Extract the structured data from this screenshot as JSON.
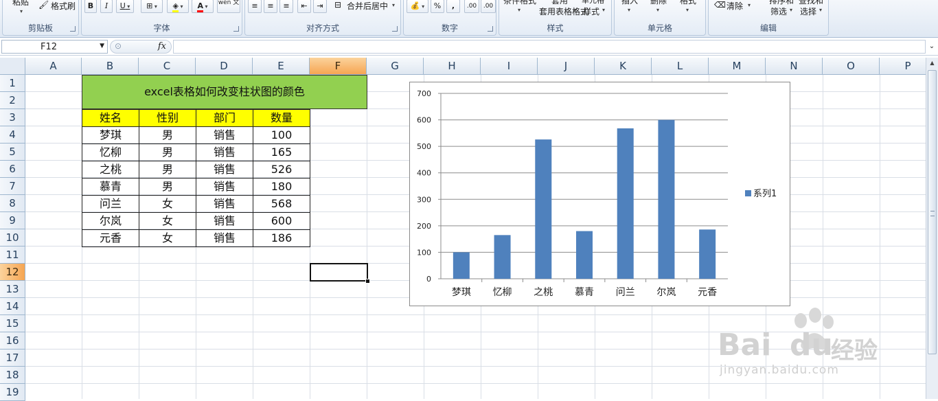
{
  "ribbon": {
    "groups": [
      {
        "label": "剪贴板"
      },
      {
        "label": "字体"
      },
      {
        "label": "对齐方式"
      },
      {
        "label": "数字"
      },
      {
        "label": "样式"
      },
      {
        "label": "单元格"
      },
      {
        "label": "编辑"
      }
    ],
    "clipboard": {
      "paste_label": "粘贴",
      "format_painter_label": "格式刷"
    },
    "font": {
      "bold": "B",
      "italic": "I",
      "underline": "U",
      "font_color": "A",
      "phonetic": "wén 文"
    },
    "alignment": {
      "merge_center_label": "合并后居中"
    },
    "number": {
      "percent": "%",
      "comma": ",",
      "inc_decimal": ".00",
      "dec_decimal": ".00"
    },
    "styles": {
      "conditional_label": "条件格式",
      "table_format_label": "套用表格格式",
      "cell_style_label": "单元格样式"
    },
    "cells": {
      "insert_label": "插入",
      "delete_label": "删除",
      "format_label": "格式"
    },
    "editing": {
      "clear_label": "清除",
      "sort_filter_label": "排序和筛选",
      "find_select_label": "查找和选择"
    }
  },
  "formula_bar": {
    "name_box": "F12",
    "fx": "fx",
    "formula": ""
  },
  "sheet": {
    "columns": [
      "A",
      "B",
      "C",
      "D",
      "E",
      "F",
      "G",
      "H",
      "I",
      "J",
      "K",
      "L",
      "M",
      "N",
      "O",
      "P"
    ],
    "selected_column": "F",
    "rows": [
      "1",
      "2",
      "3",
      "4",
      "5",
      "6",
      "7",
      "8",
      "9",
      "10",
      "11",
      "12",
      "13",
      "14",
      "15",
      "16",
      "17",
      "18",
      "19"
    ],
    "selected_row": "12",
    "title": "excel表格如何改变柱状图的颜色",
    "title_color": "#92d050",
    "header_color": "#ffff00",
    "headers": [
      "姓名",
      "性别",
      "部门",
      "数量"
    ],
    "table": [
      [
        "梦琪",
        "男",
        "销售",
        "100"
      ],
      [
        "忆柳",
        "男",
        "销售",
        "165"
      ],
      [
        "之桃",
        "男",
        "销售",
        "526"
      ],
      [
        "慕青",
        "男",
        "销售",
        "180"
      ],
      [
        "问兰",
        "女",
        "销售",
        "568"
      ],
      [
        "尔岚",
        "女",
        "销售",
        "600"
      ],
      [
        "元香",
        "女",
        "销售",
        "186"
      ]
    ]
  },
  "chart_data": {
    "type": "bar",
    "categories": [
      "梦琪",
      "忆柳",
      "之桃",
      "慕青",
      "问兰",
      "尔岚",
      "元香"
    ],
    "series": [
      {
        "name": "系列1",
        "values": [
          100,
          165,
          526,
          180,
          568,
          600,
          186
        ],
        "color": "#4f81bd"
      }
    ],
    "title": "",
    "xlabel": "",
    "ylabel": "",
    "ylim": [
      0,
      700
    ],
    "yticks": [
      "0",
      "100",
      "200",
      "300",
      "400",
      "500",
      "600",
      "700"
    ],
    "grid": true,
    "legend": "right"
  },
  "watermark": {
    "brand": "Bai",
    "brand_suffix": "du",
    "product": "经验",
    "url": "jingyan.baidu.com"
  }
}
